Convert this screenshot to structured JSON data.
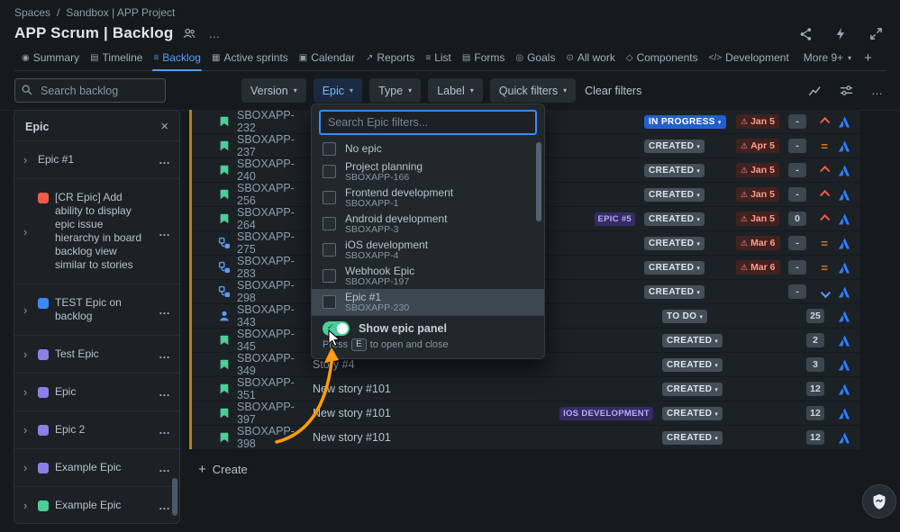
{
  "colors": {
    "accent_blue": "#579dff",
    "selected_filter_bg": "#1c2b41",
    "epic_label_purple": "#352c63",
    "due_badge_red": "#42221f",
    "in_progress_blue": "#2360cf",
    "toggle_green": "#4bce97",
    "annotation_arrow_orange": "#ff9d0b",
    "backlog_strip_yellow": "#ab8b07"
  },
  "breadcrumb": {
    "items": [
      "Spaces",
      "Sandbox | APP Project"
    ],
    "separator": "/"
  },
  "header": {
    "title": "APP Scrum | Backlog",
    "action_icons": [
      "collaborators",
      "more",
      "share",
      "automation",
      "fullscreen"
    ]
  },
  "tabs": {
    "items": [
      {
        "label": "Summary",
        "icon": "summary"
      },
      {
        "label": "Timeline",
        "icon": "timeline"
      },
      {
        "label": "Backlog",
        "icon": "backlog",
        "active": true
      },
      {
        "label": "Active sprints",
        "icon": "sprints"
      },
      {
        "label": "Calendar",
        "icon": "calendar"
      },
      {
        "label": "Reports",
        "icon": "reports"
      },
      {
        "label": "List",
        "icon": "list"
      },
      {
        "label": "Forms",
        "icon": "forms"
      },
      {
        "label": "Goals",
        "icon": "goals"
      },
      {
        "label": "All work",
        "icon": "allwork"
      },
      {
        "label": "Components",
        "icon": "components"
      },
      {
        "label": "Development",
        "icon": "development"
      },
      {
        "label": "More 9+",
        "icon": "more",
        "chevron": true
      }
    ],
    "add_label": "+"
  },
  "toolbar": {
    "search_placeholder": "Search backlog",
    "filters": [
      {
        "label": "Version"
      },
      {
        "label": "Epic",
        "active": true
      },
      {
        "label": "Type"
      },
      {
        "label": "Label"
      },
      {
        "label": "Quick filters"
      }
    ],
    "clear_filters_label": "Clear filters",
    "action_icons": [
      "insights",
      "view-settings",
      "more"
    ]
  },
  "epic_panel": {
    "title": "Epic",
    "items": [
      {
        "name": "Epic #1",
        "color": ""
      },
      {
        "name": "[CR Epic] Add ability to display epic issue hierarchy in board backlog view similar to stories",
        "color": "#ef5c48"
      },
      {
        "name": "TEST Epic on backlog",
        "color": "#388bff"
      },
      {
        "name": "Test Epic",
        "color": "#8f7ee7"
      },
      {
        "name": "Epic",
        "color": "#8f7ee7"
      },
      {
        "name": "Epic 2",
        "color": "#8f7ee7"
      },
      {
        "name": "Example Epic",
        "color": "#8f7ee7"
      },
      {
        "name": "Example Epic",
        "color": "#4bce97"
      }
    ]
  },
  "backlog": {
    "rows": [
      {
        "key": "SBOXAPP-232",
        "title": "",
        "type": "story",
        "label": "",
        "status": "IN PROGRESS",
        "due": "Jan 5",
        "estimate": "-",
        "priority": "high"
      },
      {
        "key": "SBOXAPP-237",
        "title": "",
        "type": "story",
        "label": "",
        "status": "CREATED",
        "due": "Apr 5",
        "estimate": "-",
        "priority": "medium"
      },
      {
        "key": "SBOXAPP-240",
        "title": "",
        "type": "story",
        "label": "",
        "status": "CREATED",
        "due": "Jan 5",
        "estimate": "-",
        "priority": "high"
      },
      {
        "key": "SBOXAPP-256",
        "title": "",
        "type": "story",
        "label": "",
        "status": "CREATED",
        "due": "Jan 5",
        "estimate": "-",
        "priority": "high"
      },
      {
        "key": "SBOXAPP-264",
        "title": "",
        "type": "story",
        "label": "EPIC #5",
        "status": "CREATED",
        "due": "Jan 5",
        "estimate": "0",
        "priority": "high"
      },
      {
        "key": "SBOXAPP-275",
        "title": "",
        "type": "subtask",
        "label": "",
        "status": "CREATED",
        "due": "Mar 6",
        "estimate": "-",
        "priority": "medium"
      },
      {
        "key": "SBOXAPP-283",
        "title": "",
        "type": "subtask",
        "label": "",
        "status": "CREATED",
        "due": "Mar 6",
        "estimate": "-",
        "priority": "medium"
      },
      {
        "key": "SBOXAPP-298",
        "title": "",
        "type": "subtask",
        "label": "",
        "status": "CREATED",
        "due": "",
        "estimate": "-",
        "priority": "low"
      },
      {
        "key": "SBOXAPP-343",
        "title": "",
        "type": "person",
        "label": "",
        "status": "TO DO",
        "due": "",
        "estimate": "25",
        "priority": ""
      },
      {
        "key": "SBOXAPP-345",
        "title": "",
        "type": "story",
        "label": "",
        "status": "CREATED",
        "due": "",
        "estimate": "2",
        "priority": ""
      },
      {
        "key": "SBOXAPP-349",
        "title": "Story #4",
        "type": "story",
        "label": "",
        "status": "CREATED",
        "due": "",
        "estimate": "3",
        "priority": ""
      },
      {
        "key": "SBOXAPP-351",
        "title": "New story #101",
        "type": "story",
        "label": "",
        "status": "CREATED",
        "due": "",
        "estimate": "12",
        "priority": ""
      },
      {
        "key": "SBOXAPP-397",
        "title": "New story #101",
        "type": "story",
        "label": "IOS DEVELOPMENT",
        "status": "CREATED",
        "due": "",
        "estimate": "12",
        "priority": ""
      },
      {
        "key": "SBOXAPP-398",
        "title": "New story #101",
        "type": "story",
        "label": "",
        "status": "CREATED",
        "due": "",
        "estimate": "12",
        "priority": ""
      }
    ],
    "create_label": "Create"
  },
  "epic_dropdown": {
    "search_placeholder": "Search Epic filters...",
    "options": [
      {
        "name": "No epic",
        "key": ""
      },
      {
        "name": "Project planning",
        "key": "SBOXAPP-166"
      },
      {
        "name": "Frontend development",
        "key": "SBOXAPP-1"
      },
      {
        "name": "Android development",
        "key": "SBOXAPP-3"
      },
      {
        "name": "iOS development",
        "key": "SBOXAPP-4"
      },
      {
        "name": "Webhook Epic",
        "key": "SBOXAPP-197"
      },
      {
        "name": "Epic #1",
        "key": "SBOXAPP-230",
        "highlighted": true
      }
    ],
    "toggle_label": "Show epic panel",
    "toggle_on": true,
    "hint": {
      "prefix": "Press",
      "key": "E",
      "suffix": "to open and close"
    }
  }
}
